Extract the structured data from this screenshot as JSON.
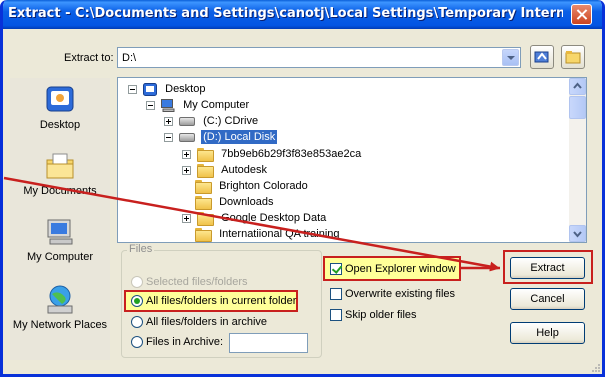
{
  "window": {
    "title": "Extract - C:\\Documents and Settings\\canotj\\Local Settings\\Temporary Internet Files\\C..."
  },
  "extract_to": {
    "label": "Extract to:",
    "value": "D:\\"
  },
  "places": [
    {
      "label": "Desktop",
      "icon": "desktop-icon"
    },
    {
      "label": "My Documents",
      "icon": "my-documents-icon"
    },
    {
      "label": "My Computer",
      "icon": "my-computer-icon"
    },
    {
      "label": "My Network Places",
      "icon": "network-places-icon"
    }
  ],
  "tree": {
    "items": [
      {
        "label": "Desktop",
        "expander": "minus",
        "icon": "desktop-icon",
        "selected": false
      },
      {
        "label": "My Computer",
        "expander": "minus",
        "icon": "computer-icon",
        "selected": false
      },
      {
        "label": "(C:) CDrive",
        "expander": "plus",
        "icon": "drive-icon",
        "selected": false
      },
      {
        "label": "(D:) Local Disk",
        "expander": "minus",
        "icon": "drive-icon",
        "selected": true
      },
      {
        "label": "7bb9eb6b29f3f83e853ae2ca",
        "expander": "plus",
        "icon": "folder-icon",
        "selected": false
      },
      {
        "label": "Autodesk",
        "expander": "plus",
        "icon": "folder-icon",
        "selected": false
      },
      {
        "label": "Brighton Colorado",
        "expander": "none",
        "icon": "folder-icon",
        "selected": false
      },
      {
        "label": "Downloads",
        "expander": "none",
        "icon": "folder-icon",
        "selected": false
      },
      {
        "label": "Google Desktop Data",
        "expander": "plus",
        "icon": "folder-icon",
        "selected": false
      },
      {
        "label": "Internatiional QA training",
        "expander": "none",
        "icon": "folder-icon",
        "selected": false
      }
    ]
  },
  "files_group": {
    "legend": "Files",
    "options": [
      {
        "label": "Selected files/folders",
        "checked": false,
        "disabled": true
      },
      {
        "label": "All files/folders in current folder",
        "checked": true,
        "disabled": false
      },
      {
        "label": "All files/folders in archive",
        "checked": false,
        "disabled": false
      },
      {
        "label": "Files in Archive:",
        "checked": false,
        "disabled": false
      }
    ],
    "archive_value": ""
  },
  "options": {
    "open_explorer": {
      "label": "Open Explorer window",
      "checked": true
    },
    "overwrite": {
      "label": "Overwrite existing files",
      "checked": false
    },
    "skip_older": {
      "label": "Skip older files",
      "checked": false
    }
  },
  "buttons": {
    "extract": "Extract",
    "cancel": "Cancel",
    "help": "Help"
  },
  "colors": {
    "title_bar": "#0a5fe6",
    "selection": "#316ac5",
    "annotation": "#c8201e",
    "annotation_fill": "#ffff99"
  }
}
